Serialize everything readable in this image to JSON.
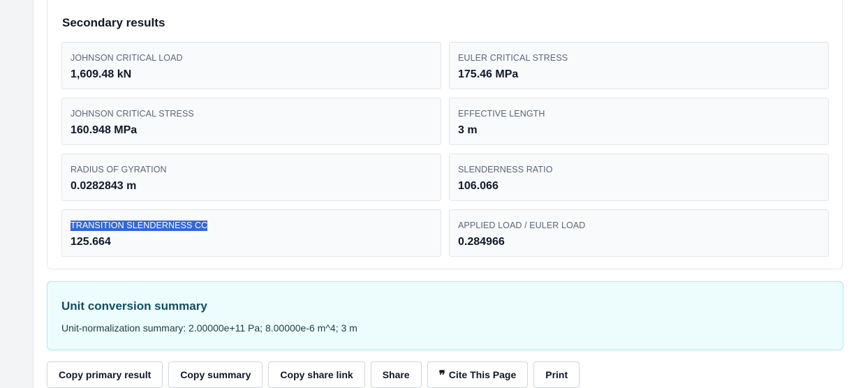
{
  "secondary": {
    "title": "Secondary results",
    "results": [
      {
        "label": "JOHNSON CRITICAL LOAD",
        "value": "1,609.48 kN"
      },
      {
        "label": "EULER CRITICAL STRESS",
        "value": "175.46 MPa"
      },
      {
        "label": "JOHNSON CRITICAL STRESS",
        "value": "160.948 MPa"
      },
      {
        "label": "EFFECTIVE LENGTH",
        "value": "3 m"
      },
      {
        "label": "RADIUS OF GYRATION",
        "value": "0.0282843 m"
      },
      {
        "label": "SLENDERNESS RATIO",
        "value": "106.066"
      },
      {
        "label": "TRANSITION SLENDERNESS CC",
        "value": "125.664"
      },
      {
        "label": "APPLIED LOAD / EULER LOAD",
        "value": "0.284966"
      }
    ]
  },
  "unit_conversion": {
    "title": "Unit conversion summary",
    "text": "Unit-normalization summary: 2.00000e+11 Pa; 8.00000e-6 m^4; 3 m"
  },
  "actions": {
    "copy_primary": "Copy primary result",
    "copy_summary": "Copy summary",
    "copy_share_link": "Copy share link",
    "share": "Share",
    "cite_icon": "quote-icon",
    "cite": "Cite This Page",
    "print": "Print"
  },
  "colors": {
    "selection": "#3367d6",
    "unit_card_bg": "#edfdfd",
    "unit_card_border": "#a5eded"
  }
}
